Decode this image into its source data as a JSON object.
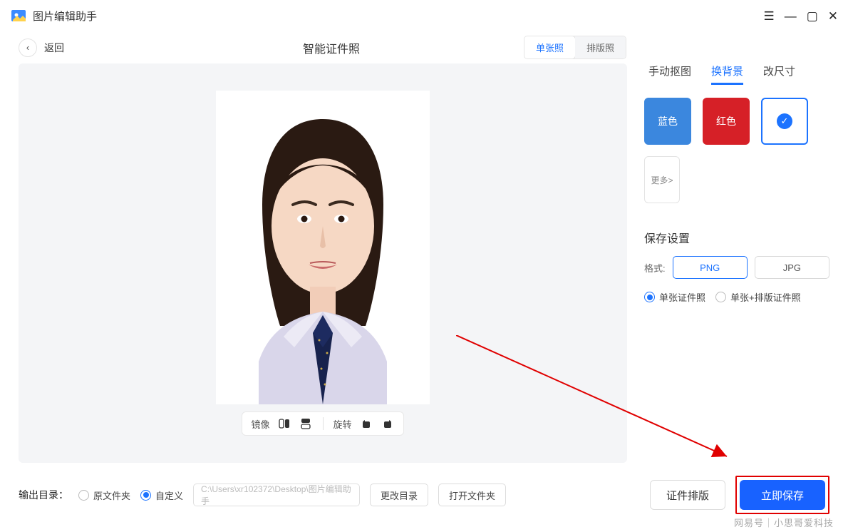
{
  "app": {
    "title": "图片编辑助手"
  },
  "header": {
    "back": "返回",
    "pageTitle": "智能证件照",
    "modes": {
      "single": "单张照",
      "layout": "排版照"
    }
  },
  "imgToolbar": {
    "mirror": "镜像",
    "rotate": "旋转"
  },
  "panel": {
    "tabs": {
      "cutout": "手动抠图",
      "bg": "换背景",
      "resize": "改尺寸"
    },
    "colors": {
      "blue": "蓝色",
      "red": "红色",
      "more": "更多>"
    },
    "saveTitle": "保存设置",
    "formatLabel": "格式:",
    "formats": {
      "png": "PNG",
      "jpg": "JPG"
    },
    "radios": {
      "single": "单张证件照",
      "combo": "单张+排版证件照"
    }
  },
  "footer": {
    "outputLabel": "输出目录：",
    "radios": {
      "orig": "原文件夹",
      "custom": "自定义"
    },
    "path": "C:\\Users\\xr102372\\Desktop\\图片编辑助手",
    "changeDir": "更改目录",
    "openDir": "打开文件夹",
    "layoutBtn": "证件排版",
    "saveBtn": "立即保存"
  },
  "watermark": "网易号｜小思哥爱科技"
}
